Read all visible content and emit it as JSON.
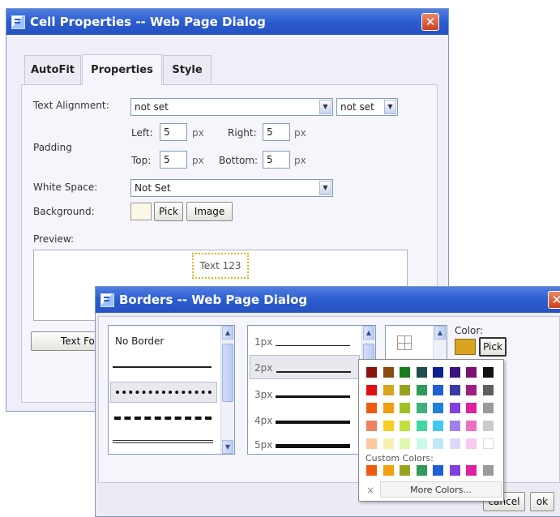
{
  "cell_dialog": {
    "title": "Cell Properties -- Web Page Dialog",
    "close_glyph": "✕",
    "tabs": [
      {
        "label": "AutoFit"
      },
      {
        "label": "Properties"
      },
      {
        "label": "Style"
      }
    ],
    "active_tab": "Properties",
    "text_alignment": {
      "label": "Text Alignment:",
      "value": "not set",
      "vertical_value": "not set"
    },
    "padding": {
      "label": "Padding",
      "left_label": "Left:",
      "left_value": "5",
      "right_label": "Right:",
      "right_value": "5",
      "top_label": "Top:",
      "top_value": "5",
      "bottom_label": "Bottom:",
      "bottom_value": "5",
      "unit": "px"
    },
    "white_space": {
      "label": "White Space:",
      "value": "Not Set"
    },
    "background": {
      "label": "Background:",
      "pick_label": "Pick",
      "image_label": "Image",
      "swatch_color": "#fbf8e8"
    },
    "preview": {
      "label": "Preview:",
      "sample_text": "Text 123"
    },
    "partial_button": "Text Fo"
  },
  "borders_dialog": {
    "title": "Borders -- Web Page Dialog",
    "styles": {
      "no_border_label": "No Border"
    },
    "widths": [
      {
        "label": "1px"
      },
      {
        "label": "2px"
      },
      {
        "label": "3px"
      },
      {
        "label": "4px"
      },
      {
        "label": "5px"
      }
    ],
    "color": {
      "label": "Color:",
      "pick_label": "Pick",
      "current_color": "#d9a521"
    },
    "cancel_label": "cancel",
    "ok_label": "ok"
  },
  "color_palette": {
    "rows": [
      [
        "#8b1111",
        "#8b4a11",
        "#1c7a20",
        "#1f4d4d",
        "#0b1f8f",
        "#3b1280",
        "#7a1070",
        "#111111"
      ],
      [
        "#e01010",
        "#d9a521",
        "#98a120",
        "#2f9a5a",
        "#1f5fd8",
        "#3a3aa8",
        "#a01e80",
        "#5f5f5f"
      ],
      [
        "#f05a10",
        "#f0a010",
        "#a0c020",
        "#40b080",
        "#2080e0",
        "#8040e0",
        "#e020a0",
        "#9a9a9a"
      ],
      [
        "#f08060",
        "#f8d020",
        "#c0e040",
        "#40d8a0",
        "#40c8f0",
        "#a080f0",
        "#f070c0",
        "#cccccc"
      ],
      [
        "#f8c8a0",
        "#f8f0b0",
        "#e0f8b0",
        "#c8f8e8",
        "#c0e8f8",
        "#e0d8f8",
        "#f8c8f0",
        "#ffffff"
      ]
    ],
    "custom_label": "Custom Colors:",
    "custom_colors": [
      "#f05a10",
      "#f0a010",
      "#98a120",
      "#2f9a5a",
      "#1f5fd8",
      "#8040e0",
      "#e020a0",
      "#9a9a9a"
    ],
    "none_glyph": "×",
    "more_label": "More Colors..."
  }
}
